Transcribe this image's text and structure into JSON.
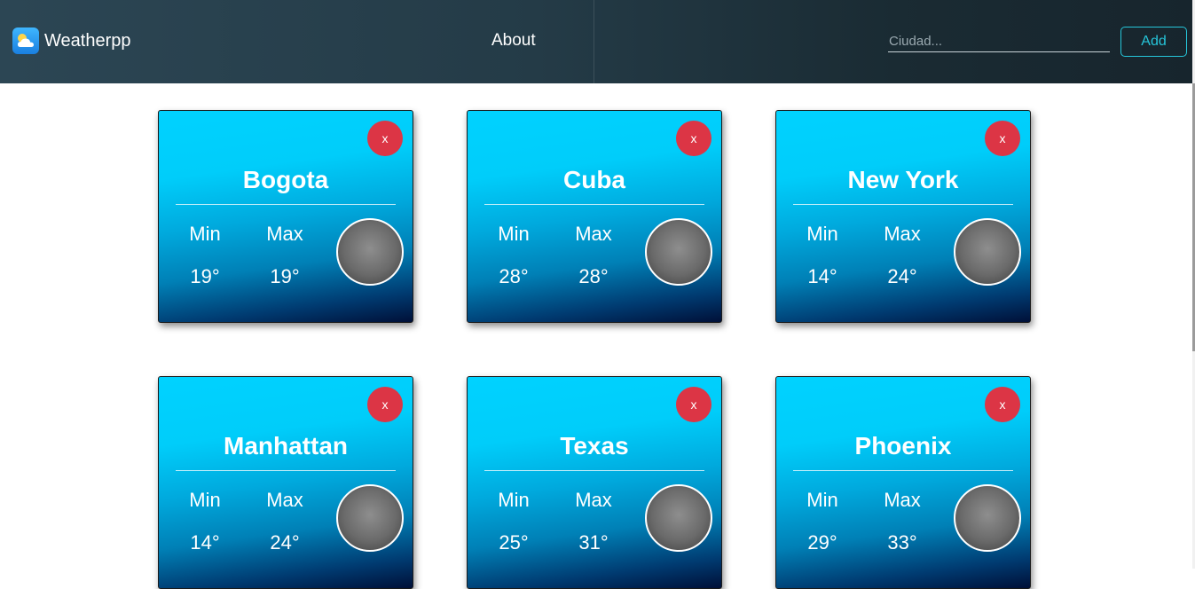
{
  "header": {
    "brand": "Weatherpp",
    "brand_icon": "cloud-sun-icon",
    "nav_about": "About",
    "search_placeholder": "Ciudad...",
    "add_label": "Add",
    "colors": {
      "accent": "#26c6da",
      "close": "#dc3545",
      "card_top": "#00d2ff",
      "card_bottom": "#001038"
    }
  },
  "cards": [
    {
      "city": "Bogota",
      "close_label": "x",
      "min_label": "Min",
      "max_label": "Max",
      "min": "19°",
      "max": "19°",
      "icon": "weather-condition-icon"
    },
    {
      "city": "Cuba",
      "close_label": "x",
      "min_label": "Min",
      "max_label": "Max",
      "min": "28°",
      "max": "28°",
      "icon": "weather-condition-icon"
    },
    {
      "city": "New York",
      "close_label": "x",
      "min_label": "Min",
      "max_label": "Max",
      "min": "14°",
      "max": "24°",
      "icon": "weather-condition-icon"
    },
    {
      "city": "Manhattan",
      "close_label": "x",
      "min_label": "Min",
      "max_label": "Max",
      "min": "14°",
      "max": "24°",
      "icon": "weather-condition-icon"
    },
    {
      "city": "Texas",
      "close_label": "x",
      "min_label": "Min",
      "max_label": "Max",
      "min": "25°",
      "max": "31°",
      "icon": "weather-condition-icon"
    },
    {
      "city": "Phoenix",
      "close_label": "x",
      "min_label": "Min",
      "max_label": "Max",
      "min": "29°",
      "max": "33°",
      "icon": "weather-condition-icon"
    }
  ]
}
